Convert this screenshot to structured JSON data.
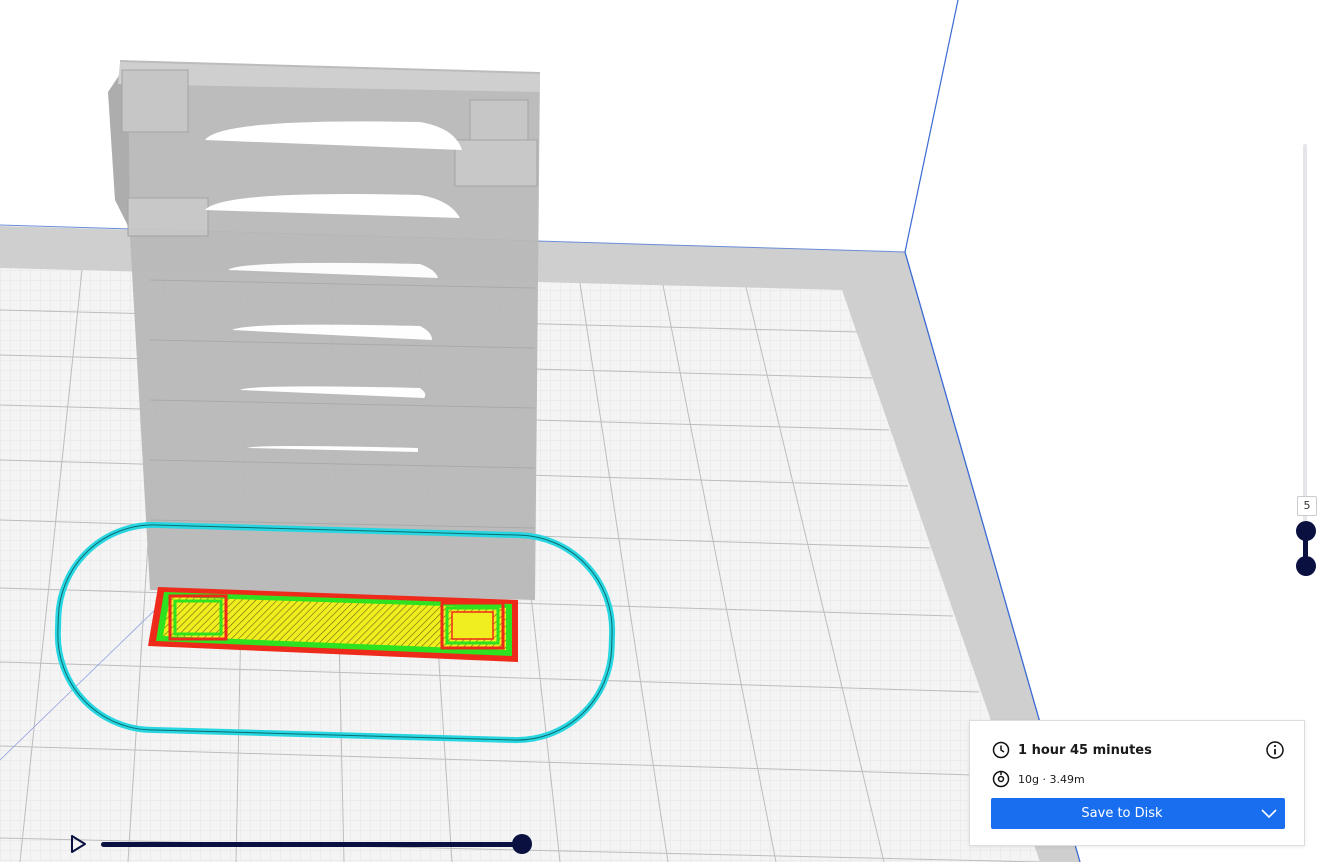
{
  "layer_slider": {
    "current_layer": "5"
  },
  "print_info": {
    "time": "1 hour 45 minutes",
    "material": "10g · 3.49m",
    "save_label": "Save to Disk"
  },
  "icons": {
    "play": "play-icon",
    "clock": "clock-icon",
    "spool": "spool-icon",
    "info": "info-icon",
    "dropdown": "chevron-down-icon"
  },
  "colors": {
    "accent": "#196ef0",
    "slider": "#0a1040",
    "skirt": "#27d6e0",
    "outer_wall": "#ee2b1a",
    "inner_wall": "#2fe21f",
    "infill": "#f0ee1e",
    "ghost_model": "#b8b8b8"
  }
}
